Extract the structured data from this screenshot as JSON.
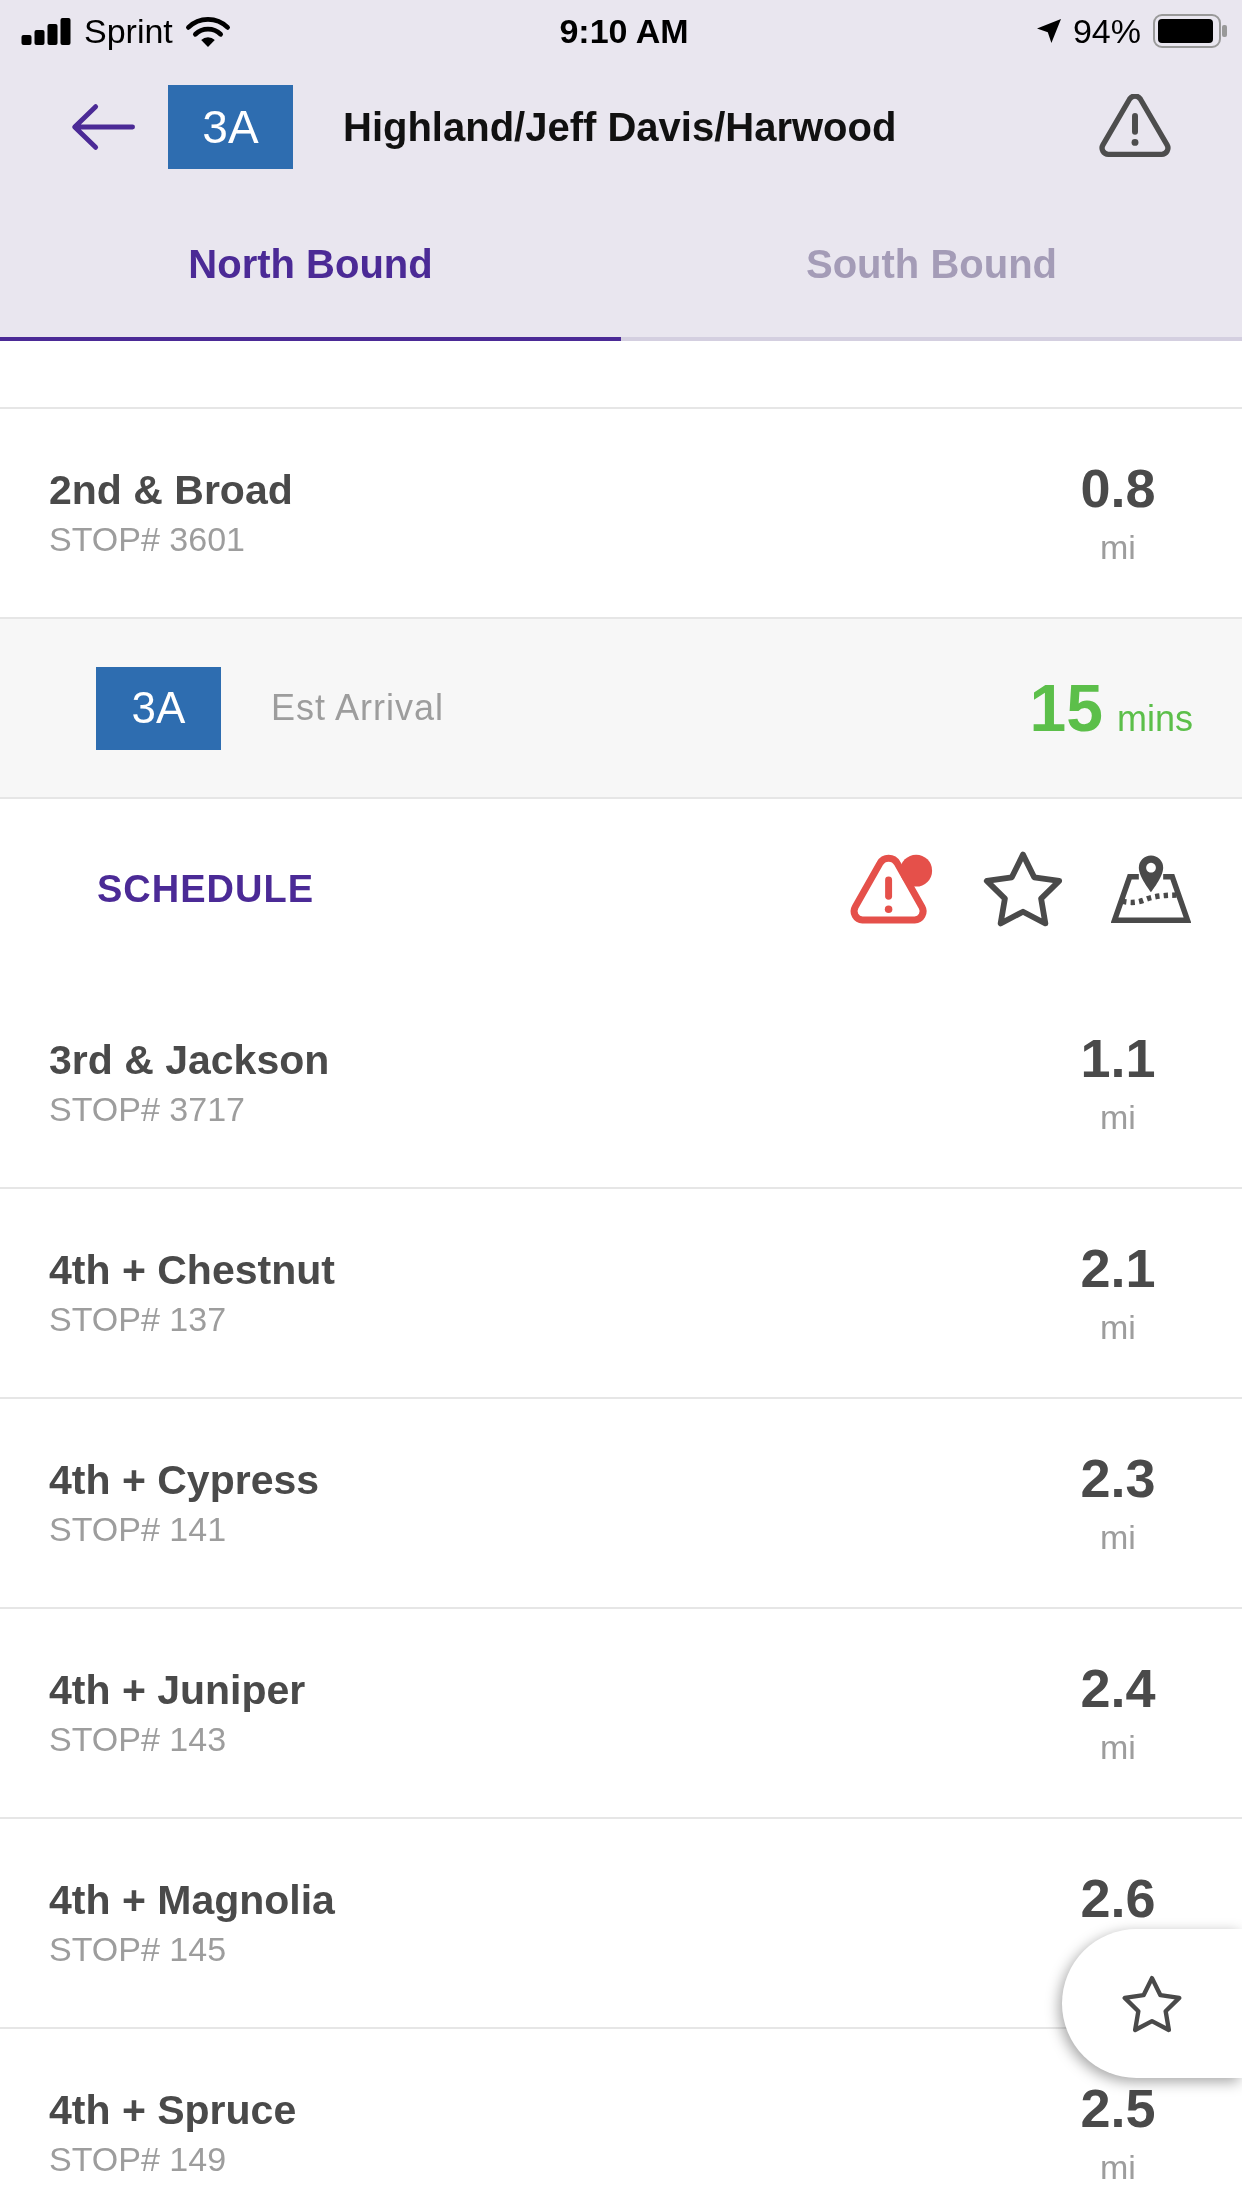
{
  "status_bar": {
    "carrier": "Sprint",
    "time": "9:10 AM",
    "battery": "94%"
  },
  "header": {
    "route": "3A",
    "title": "Highland/Jeff Davis/Harwood"
  },
  "tabs": [
    {
      "label": "North Bound",
      "selected": true
    },
    {
      "label": "South Bound",
      "selected": false
    }
  ],
  "stops": [
    {
      "name": "2nd & Broad",
      "stop": "STOP# 3601",
      "distance": "0.8",
      "unit": "mi",
      "expanded": true
    },
    {
      "name": "3rd & Jackson",
      "stop": "STOP# 3717",
      "distance": "1.1",
      "unit": "mi",
      "expanded": false
    },
    {
      "name": "4th + Chestnut",
      "stop": "STOP# 137",
      "distance": "2.1",
      "unit": "mi",
      "expanded": false
    },
    {
      "name": "4th + Cypress",
      "stop": "STOP# 141",
      "distance": "2.3",
      "unit": "mi",
      "expanded": false
    },
    {
      "name": "4th + Juniper",
      "stop": "STOP# 143",
      "distance": "2.4",
      "unit": "mi",
      "expanded": false
    },
    {
      "name": "4th + Magnolia",
      "stop": "STOP# 145",
      "distance": "2.6",
      "expanded": false
    },
    {
      "name": "4th + Spruce",
      "stop": "STOP# 149",
      "distance": "2.5",
      "unit": "mi",
      "expanded": false
    }
  ],
  "stop_detail": {
    "route": "3A",
    "label": "Est Arrival",
    "minutes": "15",
    "unit": "mins",
    "link": "SCHEDULE",
    "has_alerts": true
  }
}
